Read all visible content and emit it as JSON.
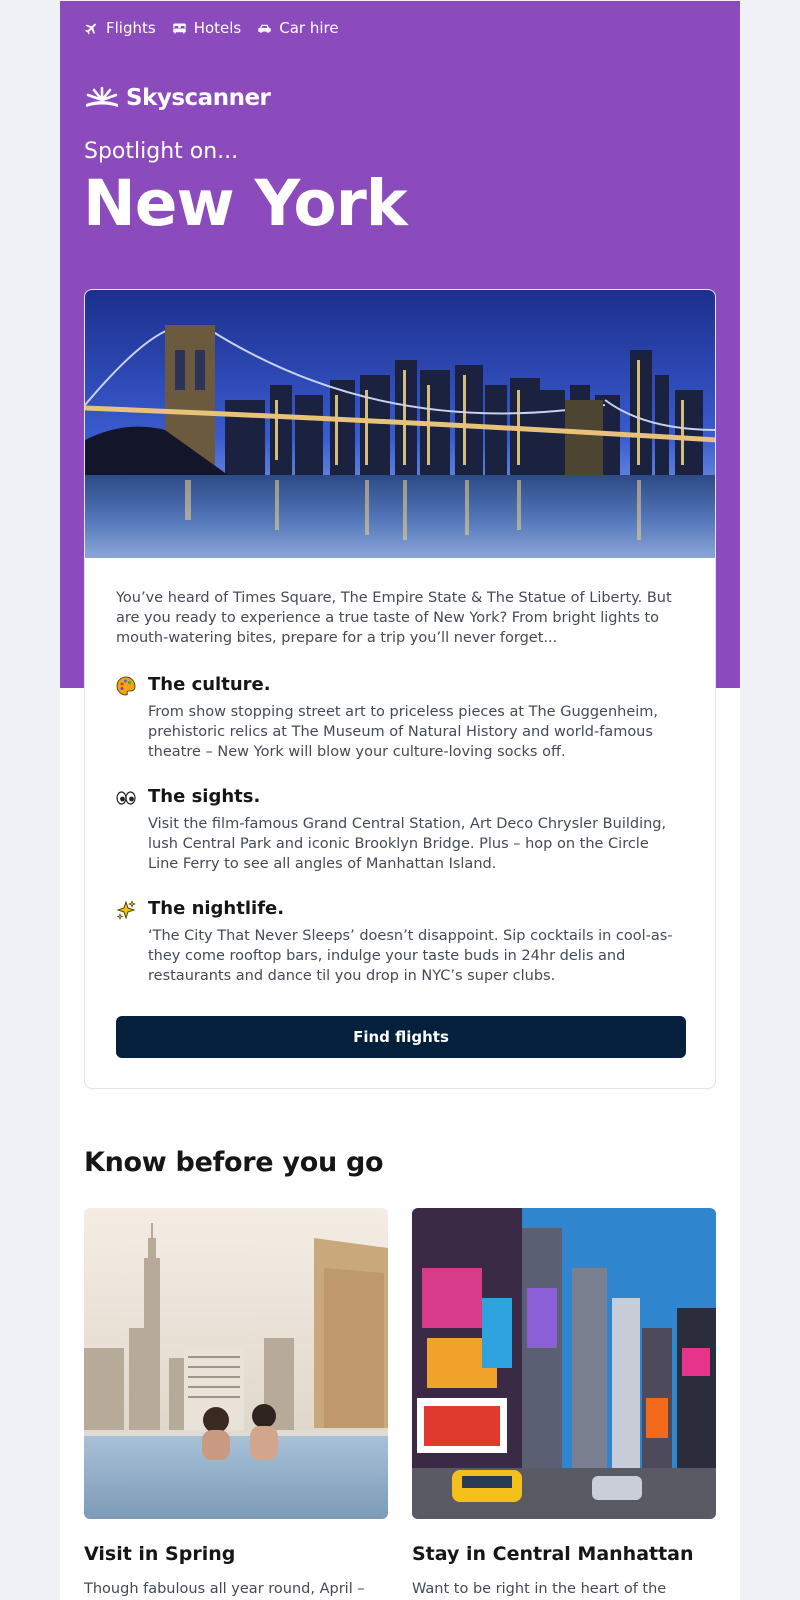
{
  "nav": {
    "items": [
      {
        "label": "Flights",
        "icon": "plane-icon"
      },
      {
        "label": "Hotels",
        "icon": "bed-icon"
      },
      {
        "label": "Car hire",
        "icon": "car-icon"
      }
    ]
  },
  "brand": {
    "name": "Skyscanner"
  },
  "hero": {
    "kicker": "Spotlight on...",
    "headline": "New York",
    "image_subject": "Brooklyn Bridge and Manhattan skyline at night"
  },
  "card": {
    "intro": "You’ve heard of Times Square, The Empire State & The Statue of Liberty. But are you ready to experience a true taste of New York? From bright lights to mouth-watering bites, prepare for a trip you’ll never forget...",
    "sections": [
      {
        "icon": "palette-icon",
        "title": "The culture.",
        "body": "From show stopping street art to priceless pieces at The Guggenheim, prehistoric relics at The Museum of Natural History and world-famous theatre – New York will blow your culture-loving socks off."
      },
      {
        "icon": "eyes-icon",
        "title": "The sights.",
        "body": "Visit the film-famous Grand Central Station, Art Deco Chrysler Building, lush Central Park and iconic Brooklyn Bridge. Plus – hop on the Circle Line Ferry to see all angles of Manhattan Island."
      },
      {
        "icon": "sparkles-icon",
        "title": "The nightlife.",
        "body": "‘The City That Never Sleeps’ doesn’t disappoint. Sip cocktails in cool-as-they come rooftop bars, indulge your taste buds in 24hr delis and restaurants and dance til you drop in NYC’s super clubs."
      }
    ],
    "cta_label": "Find flights"
  },
  "know_before": {
    "title": "Know before you go",
    "tiles": [
      {
        "title": "Visit in Spring",
        "body": "Though fabulous all year round, April – June is a great time to visit New York. NYC"
      },
      {
        "title": "Stay in Central Manhattan",
        "body": "Want to be right in the heart of the action? Check out Park Hotel in Times Square for"
      }
    ]
  },
  "colors": {
    "brand_purple": "#8b4bbd",
    "cta_navy": "#05203c",
    "page_bg": "#eff1f7",
    "body_text": "#444a58"
  }
}
